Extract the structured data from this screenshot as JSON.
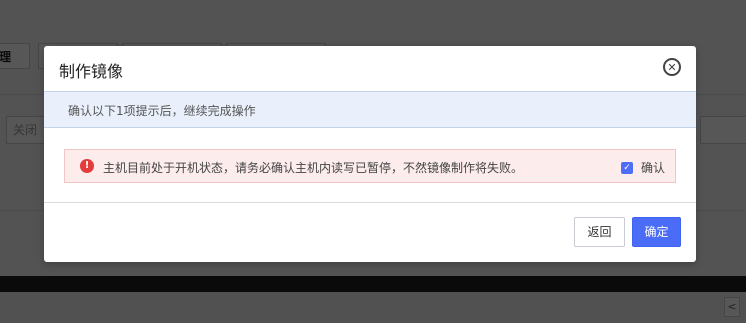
{
  "background": {
    "toolbar_button_fragment": "理",
    "filter_input_placeholder": "关闭",
    "pager_glyph": "<"
  },
  "modal": {
    "title": "制作镜像",
    "close_glyph": "✕",
    "info_text": "确认以下1项提示后，继续完成操作",
    "alert": {
      "icon_glyph": "!",
      "text": "主机目前处于开机状态，请务必确认主机内读写已暂停，不然镜像制作将失败。",
      "confirm_label": "确认",
      "confirm_checked": true
    },
    "buttons": {
      "back": "返回",
      "ok": "确定"
    }
  },
  "colors": {
    "primary": "#4a6cf7",
    "alert_bg": "#fcecec",
    "alert_icon": "#e43b3b",
    "info_bg": "#e9f0fb"
  }
}
